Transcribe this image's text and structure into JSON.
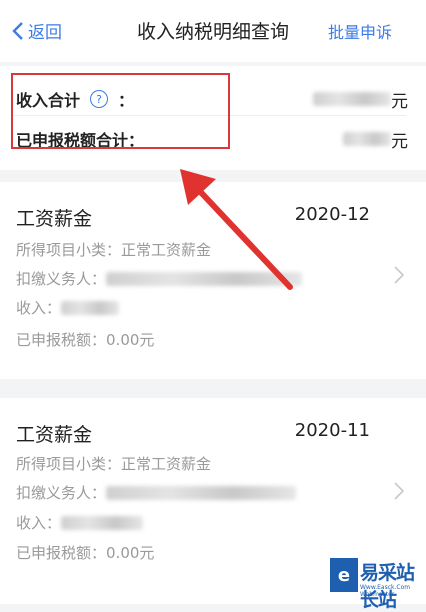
{
  "nav": {
    "back_label": "返回",
    "title": "收入纳税明细查询",
    "appeal_label": "批量申诉"
  },
  "summary": {
    "income_total_label": "收入合计",
    "colon": "：",
    "income_total_unit": "元",
    "declared_tax_total_label": "已申报税额合计：",
    "declared_tax_unit": "元"
  },
  "records": [
    {
      "category": "工资薪金",
      "period": "2020-12",
      "subtype_label": "所得项目小类：",
      "subtype_value": "正常工资薪金",
      "withholder_label": "扣缴义务人：",
      "income_label": "收入：",
      "declared_label": "已申报税额：",
      "declared_value": "0.00元"
    },
    {
      "category": "工资薪金",
      "period": "2020-11",
      "subtype_label": "所得项目小类：",
      "subtype_value": "正常工资薪金",
      "withholder_label": "扣缴义务人：",
      "income_label": "收入：",
      "declared_label": "已申报税额：",
      "declared_value": "0.00元"
    }
  ],
  "watermark": {
    "brand": "易采站长站",
    "url": "Www.Easck.Com Webmaster"
  },
  "colors": {
    "accent": "#3d7be6",
    "highlight": "#d73a3a"
  }
}
